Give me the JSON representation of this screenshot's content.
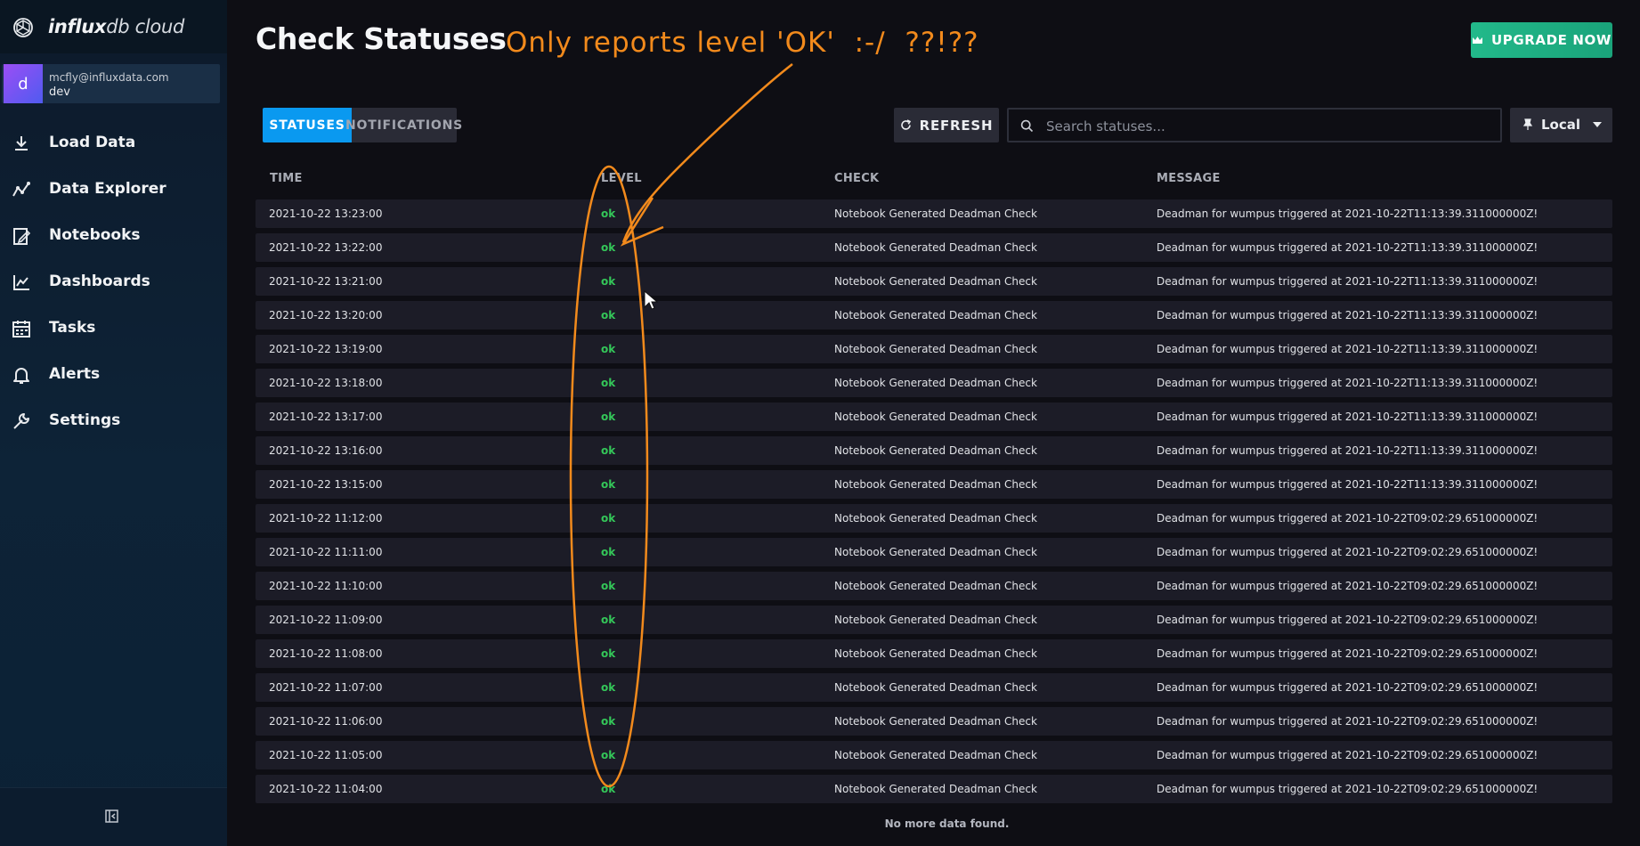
{
  "brand": {
    "name_bold": "influx",
    "name_rest": "db cloud"
  },
  "account": {
    "avatar_letter": "d",
    "email": "mcfly@influxdata.com",
    "org": "dev"
  },
  "nav": [
    {
      "label": "Load Data",
      "icon": "download-icon"
    },
    {
      "label": "Data Explorer",
      "icon": "graph-line-icon"
    },
    {
      "label": "Notebooks",
      "icon": "notebook-icon"
    },
    {
      "label": "Dashboards",
      "icon": "dashboard-chart-icon"
    },
    {
      "label": "Tasks",
      "icon": "calendar-icon"
    },
    {
      "label": "Alerts",
      "icon": "bell-icon"
    },
    {
      "label": "Settings",
      "icon": "wrench-icon"
    }
  ],
  "page": {
    "title": "Check Statuses"
  },
  "upgrade": {
    "label": "UPGRADE NOW",
    "color": "#22b98a"
  },
  "tabs": [
    {
      "label": "STATUSES",
      "active": true
    },
    {
      "label": "NOTIFICATIONS",
      "active": false
    }
  ],
  "controls": {
    "refresh_label": "REFRESH",
    "search_placeholder": "Search statuses...",
    "timezone_label": "Local"
  },
  "table": {
    "columns": [
      "TIME",
      "LEVEL",
      "CHECK",
      "MESSAGE"
    ],
    "rows": [
      {
        "time": "2021-10-22 13:23:00",
        "level": "ok",
        "check": "Notebook Generated Deadman Check",
        "message": "Deadman for wumpus triggered at 2021-10-22T11:13:39.311000000Z!"
      },
      {
        "time": "2021-10-22 13:22:00",
        "level": "ok",
        "check": "Notebook Generated Deadman Check",
        "message": "Deadman for wumpus triggered at 2021-10-22T11:13:39.311000000Z!"
      },
      {
        "time": "2021-10-22 13:21:00",
        "level": "ok",
        "check": "Notebook Generated Deadman Check",
        "message": "Deadman for wumpus triggered at 2021-10-22T11:13:39.311000000Z!"
      },
      {
        "time": "2021-10-22 13:20:00",
        "level": "ok",
        "check": "Notebook Generated Deadman Check",
        "message": "Deadman for wumpus triggered at 2021-10-22T11:13:39.311000000Z!"
      },
      {
        "time": "2021-10-22 13:19:00",
        "level": "ok",
        "check": "Notebook Generated Deadman Check",
        "message": "Deadman for wumpus triggered at 2021-10-22T11:13:39.311000000Z!"
      },
      {
        "time": "2021-10-22 13:18:00",
        "level": "ok",
        "check": "Notebook Generated Deadman Check",
        "message": "Deadman for wumpus triggered at 2021-10-22T11:13:39.311000000Z!"
      },
      {
        "time": "2021-10-22 13:17:00",
        "level": "ok",
        "check": "Notebook Generated Deadman Check",
        "message": "Deadman for wumpus triggered at 2021-10-22T11:13:39.311000000Z!"
      },
      {
        "time": "2021-10-22 13:16:00",
        "level": "ok",
        "check": "Notebook Generated Deadman Check",
        "message": "Deadman for wumpus triggered at 2021-10-22T11:13:39.311000000Z!"
      },
      {
        "time": "2021-10-22 13:15:00",
        "level": "ok",
        "check": "Notebook Generated Deadman Check",
        "message": "Deadman for wumpus triggered at 2021-10-22T11:13:39.311000000Z!"
      },
      {
        "time": "2021-10-22 11:12:00",
        "level": "ok",
        "check": "Notebook Generated Deadman Check",
        "message": "Deadman for wumpus triggered at 2021-10-22T09:02:29.651000000Z!"
      },
      {
        "time": "2021-10-22 11:11:00",
        "level": "ok",
        "check": "Notebook Generated Deadman Check",
        "message": "Deadman for wumpus triggered at 2021-10-22T09:02:29.651000000Z!"
      },
      {
        "time": "2021-10-22 11:10:00",
        "level": "ok",
        "check": "Notebook Generated Deadman Check",
        "message": "Deadman for wumpus triggered at 2021-10-22T09:02:29.651000000Z!"
      },
      {
        "time": "2021-10-22 11:09:00",
        "level": "ok",
        "check": "Notebook Generated Deadman Check",
        "message": "Deadman for wumpus triggered at 2021-10-22T09:02:29.651000000Z!"
      },
      {
        "time": "2021-10-22 11:08:00",
        "level": "ok",
        "check": "Notebook Generated Deadman Check",
        "message": "Deadman for wumpus triggered at 2021-10-22T09:02:29.651000000Z!"
      },
      {
        "time": "2021-10-22 11:07:00",
        "level": "ok",
        "check": "Notebook Generated Deadman Check",
        "message": "Deadman for wumpus triggered at 2021-10-22T09:02:29.651000000Z!"
      },
      {
        "time": "2021-10-22 11:06:00",
        "level": "ok",
        "check": "Notebook Generated Deadman Check",
        "message": "Deadman for wumpus triggered at 2021-10-22T09:02:29.651000000Z!"
      },
      {
        "time": "2021-10-22 11:05:00",
        "level": "ok",
        "check": "Notebook Generated Deadman Check",
        "message": "Deadman for wumpus triggered at 2021-10-22T09:02:29.651000000Z!"
      },
      {
        "time": "2021-10-22 11:04:00",
        "level": "ok",
        "check": "Notebook Generated Deadman Check",
        "message": "Deadman for wumpus triggered at 2021-10-22T09:02:29.651000000Z!"
      }
    ],
    "empty_message": "No more data found."
  },
  "annotation": {
    "text": "Only reports level 'OK'  :-/  ??!??",
    "color": "#f28a1c"
  },
  "colors": {
    "ok_level": "#34c759",
    "accent": "#0a99f0"
  }
}
